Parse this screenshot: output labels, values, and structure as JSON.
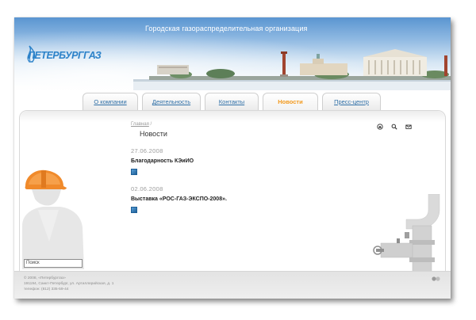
{
  "header": {
    "site_title": "Городская газораспределительная организация",
    "logo_text": "ПЕТЕРБУРГГАЗ"
  },
  "tabs": [
    {
      "label": "О компании",
      "active": false
    },
    {
      "label": "Деятельность",
      "active": false
    },
    {
      "label": "Контакты",
      "active": false
    },
    {
      "label": "Новости",
      "active": true
    },
    {
      "label": "Пресс-центр",
      "active": false
    }
  ],
  "breadcrumb": {
    "home": "Главная",
    "separator": "/"
  },
  "page_title": "Новости",
  "tools": [
    {
      "icon": "home-icon"
    },
    {
      "icon": "search-icon"
    },
    {
      "icon": "mail-icon"
    }
  ],
  "news": [
    {
      "date": "27.06.2008",
      "title": "Благодарность КЭиИО"
    },
    {
      "date": "02.06.2008",
      "title": "Выставка «РОС-ГАЗ-ЭКСПО-2008»."
    }
  ],
  "search": {
    "value": "Поиск"
  },
  "footer": {
    "lines": [
      "© 2008, «Петербурггаз»",
      "191194, Санкт-Петербург, ул. Артиллерийская, д. 1",
      "телефон: (812) 335-59-44"
    ]
  },
  "colors": {
    "accent_orange": "#f29a1f",
    "link_blue": "#2f6fa6",
    "logo_blue": "#2c82c9"
  }
}
